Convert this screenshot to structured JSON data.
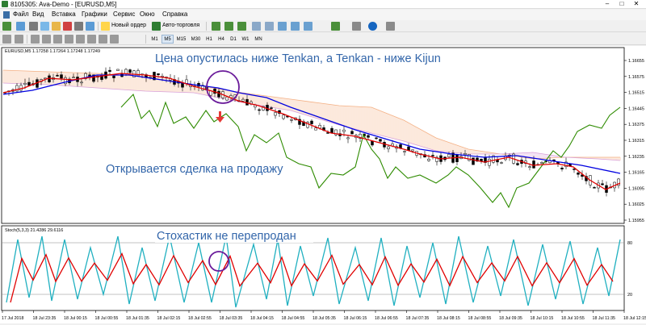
{
  "window": {
    "title": "8105305: Ava-Demo - [EURUSD,M5]"
  },
  "menu": [
    "Файл",
    "Вид",
    "Вставка",
    "Графики",
    "Сервис",
    "Окно",
    "Справка"
  ],
  "toolbar": {
    "new_order": "Новый ордер",
    "autotrading": "Авто-торговля"
  },
  "timeframes": [
    "M1",
    "M5",
    "M15",
    "M30",
    "H1",
    "H4",
    "D1",
    "W1",
    "MN"
  ],
  "active_timeframe": "M5",
  "main_chart": {
    "info": "EURUSD,M5  1.17258 1.17264 1.17248 1.17249",
    "price_labels": [
      "1.16655",
      "1.16575",
      "1.16515",
      "1.16445",
      "1.16375",
      "1.16315",
      "1.16235",
      "1.16165",
      "1.16095",
      "1.16025",
      "1.15955"
    ],
    "annotation_top": "Цена опустилась ниже Tenkan, а Tenkan - ниже Kijun",
    "annotation_mid": "Открывается сделка на продажу"
  },
  "stoch": {
    "info": "Stoch(5,3,3) 21.4286 29.6116",
    "level_labels": [
      "80",
      "20"
    ],
    "annotation": "Стохастик не перепродан"
  },
  "time_labels": [
    "17 Jul 2018",
    "18 Jul 23:35",
    "18 Jul 00:15",
    "18 Jul 00:55",
    "18 Jul 01:35",
    "18 Jul 02:15",
    "18 Jul 02:55",
    "18 Jul 03:35",
    "18 Jul 04:15",
    "18 Jul 04:55",
    "18 Jul 05:35",
    "18 Jul 06:15",
    "18 Jul 06:55",
    "18 Jul 07:35",
    "18 Jul 08:15",
    "18 Jul 08:55",
    "18 Jul 09:35",
    "18 Jul 10:15",
    "18 Jul 10:55",
    "18 Jul 11:35",
    "18 Jul 12:15"
  ],
  "colors": {
    "tenkan": "#e00000",
    "kijun": "#0000e0",
    "chikou": "#2e8b00",
    "kumo_up": "#f4b084",
    "kumo_down": "#d8a0d8",
    "stoch_main": "#20b0c0",
    "stoch_signal": "#e00000",
    "annotation": "#3366aa",
    "circle": "#6a1b9a",
    "arrow": "#e53935"
  }
}
